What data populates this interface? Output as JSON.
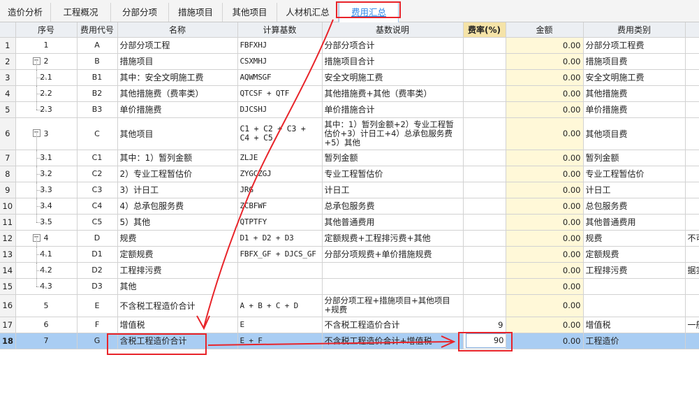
{
  "tabs": [
    {
      "label": "造价分析"
    },
    {
      "label": "工程概况"
    },
    {
      "label": "分部分项"
    },
    {
      "label": "措施项目"
    },
    {
      "label": "其他项目"
    },
    {
      "label": "人材机汇总"
    },
    {
      "label": "费用汇总"
    }
  ],
  "columns": {
    "seq": "序号",
    "code": "费用代号",
    "name": "名称",
    "base": "计算基数",
    "desc": "基数说明",
    "rate": "费率(%)",
    "amount": "金额",
    "type": "费用类别"
  },
  "rows": [
    {
      "n": "1",
      "seq": "1",
      "code": "A",
      "name": "分部分项工程",
      "base": "FBFXHJ",
      "desc": "分部分项合计",
      "rate": "",
      "amount": "0.00",
      "type": "分部分项工程费",
      "extra": ""
    },
    {
      "n": "2",
      "seq": "2",
      "code": "B",
      "name": "措施项目",
      "base": "CSXMHJ",
      "desc": "措施项目合计",
      "rate": "",
      "amount": "0.00",
      "type": "措施项目费",
      "extra": ""
    },
    {
      "n": "3",
      "seq": "2.1",
      "code": "B1",
      "name": "其中：安全文明施工费",
      "base": "AQWMSGF",
      "desc": "安全文明施工费",
      "rate": "",
      "amount": "0.00",
      "type": "安全文明施工费",
      "extra": ""
    },
    {
      "n": "4",
      "seq": "2.2",
      "code": "B2",
      "name": "其他措施费（费率类）",
      "base": "QTCSF + QTF",
      "desc": "其他措施费+其他（费率类）",
      "rate": "",
      "amount": "0.00",
      "type": "其他措施费",
      "extra": ""
    },
    {
      "n": "5",
      "seq": "2.3",
      "code": "B3",
      "name": "单价措施费",
      "base": "DJCSHJ",
      "desc": "单价措施合计",
      "rate": "",
      "amount": "0.00",
      "type": "单价措施费",
      "extra": ""
    },
    {
      "n": "6",
      "seq": "3",
      "code": "C",
      "name": "其他项目",
      "base": "C1 + C2 + C3 + C4 + C5",
      "desc": "其中：1）暂列金额+2）专业工程暂估价+3）计日工+4）总承包服务费+5）其他",
      "rate": "",
      "amount": "0.00",
      "type": "其他项目费",
      "extra": ""
    },
    {
      "n": "7",
      "seq": "3.1",
      "code": "C1",
      "name": "其中：1）暂列金额",
      "base": "ZLJE",
      "desc": "暂列金额",
      "rate": "",
      "amount": "0.00",
      "type": "暂列金额",
      "extra": ""
    },
    {
      "n": "8",
      "seq": "3.2",
      "code": "C2",
      "name": "2）专业工程暂估价",
      "base": "ZYGCZGJ",
      "desc": "专业工程暂估价",
      "rate": "",
      "amount": "0.00",
      "type": "专业工程暂估价",
      "extra": ""
    },
    {
      "n": "9",
      "seq": "3.3",
      "code": "C3",
      "name": "3）计日工",
      "base": "JRG",
      "desc": "计日工",
      "rate": "",
      "amount": "0.00",
      "type": "计日工",
      "extra": ""
    },
    {
      "n": "10",
      "seq": "3.4",
      "code": "C4",
      "name": "4）总承包服务费",
      "base": "ZCBFWF",
      "desc": "总承包服务费",
      "rate": "",
      "amount": "0.00",
      "type": "总包服务费",
      "extra": ""
    },
    {
      "n": "11",
      "seq": "3.5",
      "code": "C5",
      "name": "5）其他",
      "base": "QTPTFY",
      "desc": "其他普通费用",
      "rate": "",
      "amount": "0.00",
      "type": "其他普通费用",
      "extra": ""
    },
    {
      "n": "12",
      "seq": "4",
      "code": "D",
      "name": "规费",
      "base": "D1 + D2 + D3",
      "desc": "定额规费+工程排污费+其他",
      "rate": "",
      "amount": "0.00",
      "type": "规费",
      "extra": "不可"
    },
    {
      "n": "13",
      "seq": "4.1",
      "code": "D1",
      "name": "定额规费",
      "base": "FBFX_GF + DJCS_GF",
      "desc": "分部分项规费+单价措施规费",
      "rate": "",
      "amount": "0.00",
      "type": "定额规费",
      "extra": ""
    },
    {
      "n": "14",
      "seq": "4.2",
      "code": "D2",
      "name": "工程排污费",
      "base": "",
      "desc": "",
      "rate": "",
      "amount": "0.00",
      "type": "工程排污费",
      "extra": "据实"
    },
    {
      "n": "15",
      "seq": "4.3",
      "code": "D3",
      "name": "其他",
      "base": "",
      "desc": "",
      "rate": "",
      "amount": "0.00",
      "type": "",
      "extra": ""
    },
    {
      "n": "16",
      "seq": "5",
      "code": "E",
      "name": "不含税工程造价合计",
      "base": "A + B + C + D",
      "desc": "分部分项工程+措施项目+其他项目+规费",
      "rate": "",
      "amount": "0.00",
      "type": "",
      "extra": ""
    },
    {
      "n": "17",
      "seq": "6",
      "code": "F",
      "name": "增值税",
      "base": "E",
      "desc": "不含税工程造价合计",
      "rate": "9",
      "amount": "0.00",
      "type": "增值税",
      "extra": "一般"
    },
    {
      "n": "18",
      "seq": "7",
      "code": "G",
      "name": "含税工程造价合计",
      "base": "E + F",
      "desc": "不含税工程造价合计+增值税",
      "rate": "90",
      "amount": "0.00",
      "type": "工程造价",
      "extra": ""
    }
  ],
  "colors": {
    "annotation": "#e8242a",
    "selected_row": "#a9cdf3",
    "amount_bg": "#fff8d8",
    "active_tab": "#2c87e8"
  }
}
